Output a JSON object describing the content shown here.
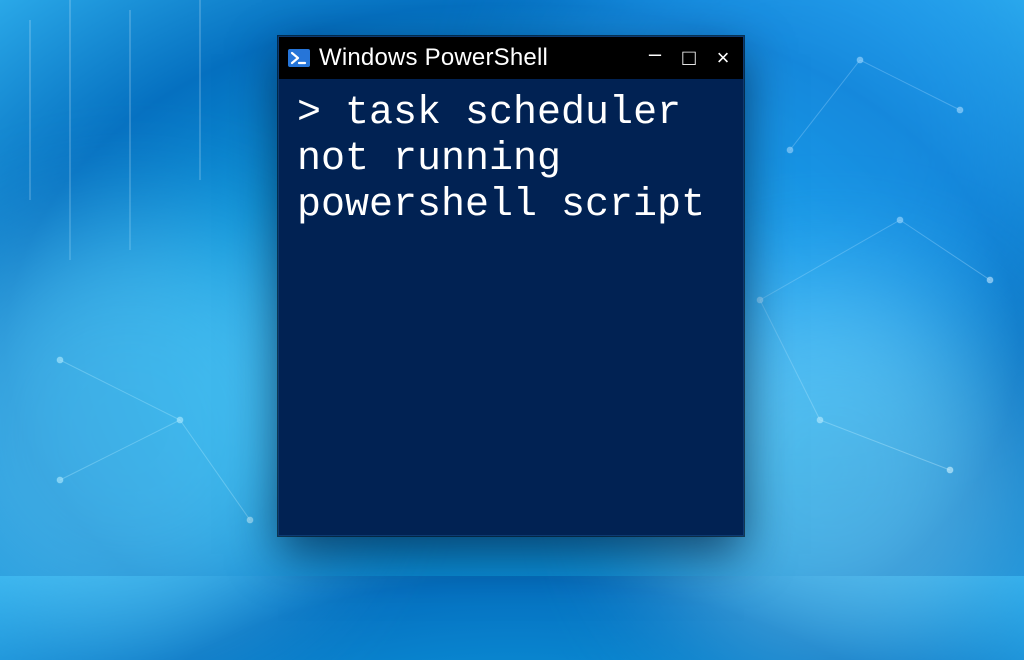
{
  "window": {
    "title": "Windows PowerShell",
    "controls": {
      "minimize": "–",
      "maximize": "□",
      "close": "×"
    }
  },
  "terminal": {
    "prompt": ">",
    "command": "task scheduler not running powershell script"
  },
  "colors": {
    "terminal_bg": "#012253",
    "titlebar_bg": "#000000",
    "text": "#ffffff"
  }
}
